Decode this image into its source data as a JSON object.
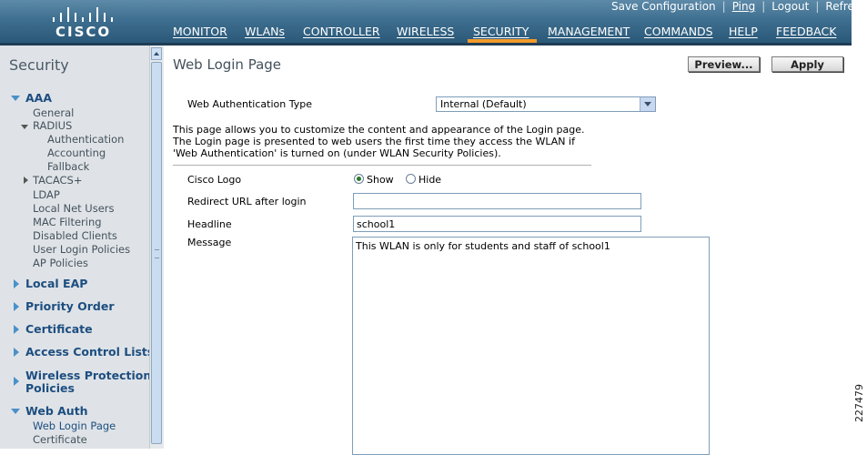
{
  "header": {
    "logo_text": "CISCO",
    "top_links": [
      "Save Configuration",
      "Ping",
      "Logout",
      "Refresh"
    ],
    "nav": [
      "MONITOR",
      "WLANs",
      "CONTROLLER",
      "WIRELESS",
      "SECURITY",
      "MANAGEMENT",
      "COMMANDS",
      "HELP",
      "FEEDBACK"
    ],
    "active_nav": "SECURITY",
    "accent_color": "#f39a2a"
  },
  "sidebar": {
    "title": "Security",
    "aaa": {
      "label": "AAA",
      "general": "General",
      "radius": "RADIUS",
      "radius_items": [
        "Authentication",
        "Accounting",
        "Fallback"
      ],
      "tacacs": "TACACS+",
      "more": [
        "LDAP",
        "Local Net Users",
        "MAC Filtering",
        "Disabled Clients",
        "User Login Policies",
        "AP Policies"
      ]
    },
    "sections": [
      "Local EAP",
      "Priority Order",
      "Certificate",
      "Access Control Lists",
      "Wireless Protection",
      "Policies"
    ],
    "web_auth": {
      "label": "Web Auth",
      "items": [
        "Web Login Page",
        "Certificate"
      ]
    }
  },
  "content": {
    "title": "Web Login Page",
    "preview_button": "Preview...",
    "apply_button": "Apply",
    "auth_type_label": "Web Authentication Type",
    "auth_type_value": "Internal (Default)",
    "description": "This page allows you to customize the content and appearance of the Login page. The Login page is presented to web users the first time they access the WLAN if 'Web Authentication' is turned on (under WLAN Security Policies).",
    "cisco_logo_label": "Cisco Logo",
    "show_label": "Show",
    "hide_label": "Hide",
    "cisco_logo_selected": "Show",
    "redirect_label": "Redirect URL after login",
    "redirect_value": "",
    "headline_label": "Headline",
    "headline_value": "school1",
    "message_label": "Message",
    "message_value": "This  WLAN is only for students and staff of school1"
  },
  "figure_number": "227479"
}
